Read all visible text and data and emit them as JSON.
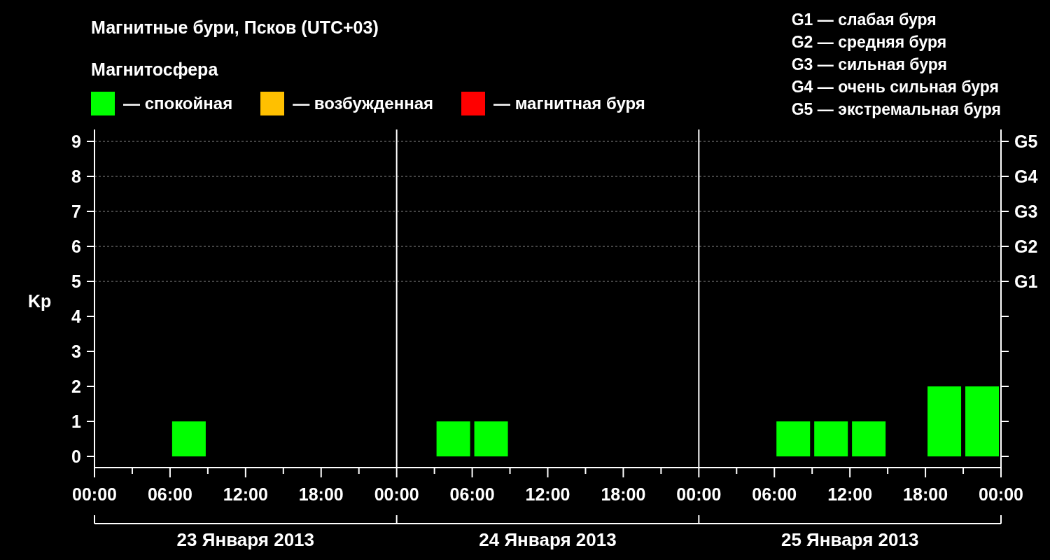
{
  "title": "Магнитные бури, Псков (UTC+03)",
  "legend": {
    "title": "Магнитосфера",
    "items": [
      {
        "label": "— спокойная",
        "color": "#00ff00"
      },
      {
        "label": "— возбужденная",
        "color": "#ffc000"
      },
      {
        "label": "— магнитная буря",
        "color": "#ff0000"
      }
    ]
  },
  "scale": [
    "G1 — слабая буря",
    "G2 — средняя буря",
    "G3 — сильная буря",
    "G4 — очень сильная буря",
    "G5 — экстремальная буря"
  ],
  "chart": {
    "chart_data": {
      "type": "bar",
      "ylabel": "Kp",
      "grid": true,
      "x": [
        "2013-01-23T01:30",
        "2013-01-23T04:30",
        "2013-01-23T07:30",
        "2013-01-23T10:30",
        "2013-01-23T13:30",
        "2013-01-23T16:30",
        "2013-01-23T19:30",
        "2013-01-23T22:30",
        "2013-01-24T01:30",
        "2013-01-24T04:30",
        "2013-01-24T07:30",
        "2013-01-24T10:30",
        "2013-01-24T13:30",
        "2013-01-24T16:30",
        "2013-01-24T19:30",
        "2013-01-24T22:30",
        "2013-01-25T01:30",
        "2013-01-25T04:30",
        "2013-01-25T07:30",
        "2013-01-25T10:30",
        "2013-01-25T13:30",
        "2013-01-25T16:30",
        "2013-01-25T19:30",
        "2013-01-25T22:30"
      ],
      "series": [
        {
          "color": "#00ff00",
          "values": [
            0,
            0,
            1,
            0,
            0,
            0,
            0,
            0,
            0,
            1,
            1,
            0,
            0,
            0,
            0,
            0,
            0,
            0,
            1,
            1,
            1,
            0,
            2,
            2
          ]
        }
      ],
      "xlim": [
        "2013-01-23T00:00",
        "2013-01-26T00:00"
      ],
      "ylim": [
        -0.32,
        9.34
      ],
      "yticks": [
        0,
        1,
        2,
        3,
        4,
        5,
        6,
        7,
        8,
        9
      ],
      "xticks": [
        {
          "value": "2013-01-23T00:00",
          "label": "00:00"
        },
        {
          "value": "2013-01-23T06:00",
          "label": "06:00"
        },
        {
          "value": "2013-01-23T12:00",
          "label": "12:00"
        },
        {
          "value": "2013-01-23T18:00",
          "label": "18:00"
        },
        {
          "value": "2013-01-24T00:00",
          "label": "00:00"
        },
        {
          "value": "2013-01-24T06:00",
          "label": "06:00"
        },
        {
          "value": "2013-01-24T12:00",
          "label": "12:00"
        },
        {
          "value": "2013-01-24T18:00",
          "label": "18:00"
        },
        {
          "value": "2013-01-25T00:00",
          "label": "00:00"
        },
        {
          "value": "2013-01-25T06:00",
          "label": "06:00"
        },
        {
          "value": "2013-01-25T12:00",
          "label": "12:00"
        },
        {
          "value": "2013-01-25T18:00",
          "label": "18:00"
        },
        {
          "value": "2013-01-26T00:00",
          "label": "00:00"
        }
      ]
    },
    "right_axis": [
      "G5",
      "G4",
      "G3",
      "G2",
      "G1"
    ],
    "day_labels": [
      "23 Января 2013",
      "24 Января 2013",
      "25 Января 2013"
    ]
  }
}
